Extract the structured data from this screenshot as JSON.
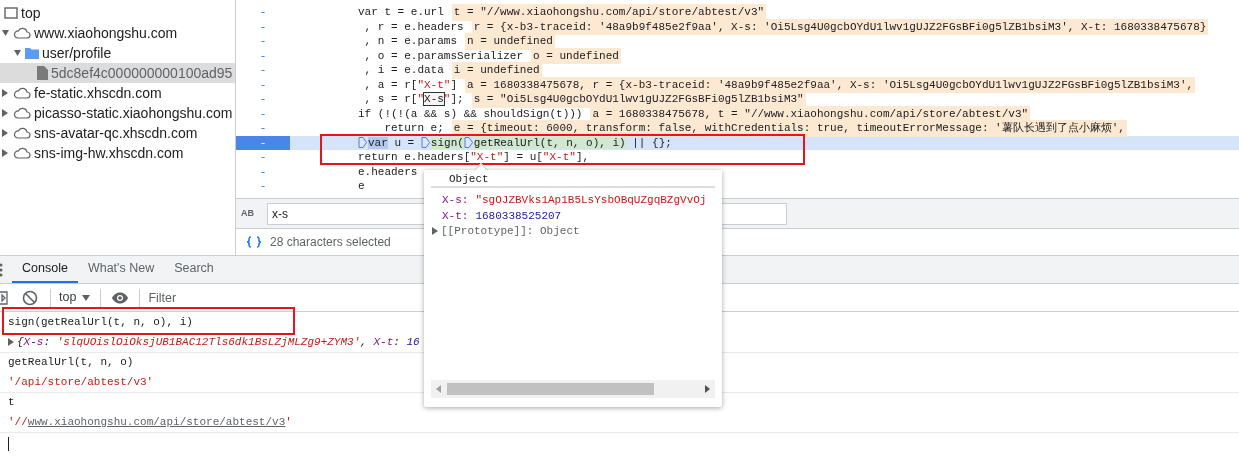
{
  "sources_tree": [
    {
      "kind": "frame",
      "label": "top",
      "selected": false
    },
    {
      "kind": "domain",
      "label": "www.xiaohongshu.com",
      "expanded": true,
      "selected": false,
      "children": [
        {
          "kind": "folder",
          "label": "user/profile",
          "expanded": true,
          "selected": false,
          "children": [
            {
              "kind": "file",
              "label": "5dc8ef4c000000000100ad95",
              "selected": true
            }
          ]
        }
      ]
    },
    {
      "kind": "domain",
      "label": "fe-static.xhscdn.com",
      "expanded": false,
      "selected": false
    },
    {
      "kind": "domain",
      "label": "picasso-static.xiaohongshu.com",
      "expanded": false,
      "selected": false
    },
    {
      "kind": "domain",
      "label": "sns-avatar-qc.xhscdn.com",
      "expanded": false,
      "selected": false
    },
    {
      "kind": "domain",
      "label": "sns-img-hw.xhscdn.com",
      "expanded": false,
      "selected": false
    }
  ],
  "editor": {
    "lines": [
      {
        "gutter": "-",
        "current": false,
        "segments": [
          {
            "kind": "code",
            "text": "          var t = e.url"
          }
        ],
        "inline_value": "t = \"//www.xiaohongshu.com/api/store/abtest/v3\""
      },
      {
        "gutter": "-",
        "current": false,
        "segments": [
          {
            "kind": "code",
            "text": "           , r = e.headers"
          }
        ],
        "inline_value": "r = {x-b3-traceid: '48a9b9f485e2f9aa', X-s: 'Oi5Lsg4U0gcbOYdU1lwv1gUJZ2FGsBFi0g5lZB1bsiM3', X-t: 1680338475678}"
      },
      {
        "gutter": "-",
        "current": false,
        "segments": [
          {
            "kind": "code",
            "text": "           , n = e.params"
          }
        ],
        "inline_value": "n = undefined"
      },
      {
        "gutter": "-",
        "current": false,
        "segments": [
          {
            "kind": "code",
            "text": "           , o = e.paramsSerializer"
          }
        ],
        "inline_value": "o = undefined"
      },
      {
        "gutter": "-",
        "current": false,
        "segments": [
          {
            "kind": "code",
            "text": "           , i = e.data"
          }
        ],
        "inline_value": "i = undefined"
      },
      {
        "gutter": "-",
        "current": false,
        "segments": [
          {
            "kind": "code",
            "text": "           , a = r["
          },
          {
            "kind": "string",
            "text": "\"X-t\""
          },
          {
            "kind": "code",
            "text": "]"
          }
        ],
        "inline_value": "a = 1680338475678, r = {x-b3-traceid: '48a9b9f485e2f9aa', X-s: 'Oi5Lsg4U0gcbOYdU1lwv1gUJZ2FGsBFi0g5lZB1bsiM3',"
      },
      {
        "gutter": "-",
        "current": false,
        "segments": [
          {
            "kind": "code",
            "text": "           , s = r["
          },
          {
            "kind": "string",
            "text": "\""
          },
          {
            "kind": "match",
            "text": "X-s"
          },
          {
            "kind": "string",
            "text": "\""
          },
          {
            "kind": "code",
            "text": "];"
          }
        ],
        "inline_value": "s = \"Oi5Lsg4U0gcbOYdU1lwv1gUJZ2FGsBFi0g5lZB1bsiM3\""
      },
      {
        "gutter": "-",
        "current": false,
        "segments": [
          {
            "kind": "code",
            "text": "          if (!(!(a && s) && shouldSign(t)))"
          }
        ],
        "inline_value": "a = 1680338475678, t = \"//www.xiaohongshu.com/api/store/abtest/v3\""
      },
      {
        "gutter": "-",
        "current": false,
        "segments": [
          {
            "kind": "code",
            "text": "              return e;"
          }
        ],
        "inline_value": "e = {timeout: 6000, transform: false, withCredentials: true, timeoutErrorMessage: '薯队长遇到了点小麻烦',"
      },
      {
        "gutter": "-",
        "current": true,
        "segments": [
          {
            "kind": "marker"
          },
          {
            "kind": "word-highlight",
            "text": "var"
          },
          {
            "kind": "code",
            "text": " u = "
          },
          {
            "kind": "marker"
          },
          {
            "kind": "selection",
            "text": "sign("
          },
          {
            "kind": "marker"
          },
          {
            "kind": "selection",
            "text": "getRealUrl(t, n, o), i)"
          },
          {
            "kind": "code",
            "text": " || {};"
          }
        ]
      },
      {
        "gutter": "-",
        "current": false,
        "segments": [
          {
            "kind": "code",
            "text": "          return e.headers["
          },
          {
            "kind": "string",
            "text": "\"X-t\""
          },
          {
            "kind": "code",
            "text": "] = u["
          },
          {
            "kind": "string",
            "text": "\"X-t\""
          },
          {
            "kind": "code",
            "text": "],"
          }
        ]
      },
      {
        "gutter": "-",
        "current": false,
        "segments": [
          {
            "kind": "code",
            "text": "          e.headers"
          }
        ]
      },
      {
        "gutter": "-",
        "current": false,
        "segments": [
          {
            "kind": "code",
            "text": "          e"
          }
        ]
      }
    ]
  },
  "search_bar": {
    "case_toggle": "AB",
    "value": "x-s"
  },
  "status_bar": {
    "text": "28 characters selected"
  },
  "console": {
    "tabs": [
      {
        "label": "Console",
        "selected": true
      },
      {
        "label": "What's New",
        "selected": false
      },
      {
        "label": "Search",
        "selected": false
      }
    ],
    "context": "top",
    "filter": {
      "placeholder": "Filter"
    },
    "entries": [
      {
        "kind": "input",
        "segments": [
          {
            "kind": "code",
            "text": "sign(getRealUrl(t, n, o), i)"
          }
        ]
      },
      {
        "kind": "result",
        "segments": [
          {
            "kind": "code",
            "text": "{"
          },
          {
            "kind": "key",
            "text": "X-s"
          },
          {
            "kind": "code",
            "text": ": "
          },
          {
            "kind": "string",
            "text": "'slqUOislOiOksjUB1BAC12Tls6dk1BsLZjMLZg9+ZYM3'"
          },
          {
            "kind": "code",
            "text": ", "
          },
          {
            "kind": "key",
            "text": "X-t"
          },
          {
            "kind": "code",
            "text": ": "
          },
          {
            "kind": "number",
            "text": "16"
          }
        ]
      },
      {
        "kind": "input",
        "segments": [
          {
            "kind": "code",
            "text": "getRealUrl(t, n, o)"
          }
        ]
      },
      {
        "kind": "result",
        "segments": [
          {
            "kind": "string",
            "text": "'/api/store/abtest/v3'"
          }
        ]
      },
      {
        "kind": "input",
        "segments": [
          {
            "kind": "code",
            "text": "t"
          }
        ]
      },
      {
        "kind": "result",
        "segments": [
          {
            "kind": "string",
            "text": "'//"
          },
          {
            "kind": "link",
            "text": "www.xiaohongshu.com/api/store/abtest/v3"
          },
          {
            "kind": "string",
            "text": "'"
          }
        ]
      }
    ]
  },
  "popup": {
    "title": "Object",
    "properties": [
      {
        "key": "X-s:",
        "kind": "string",
        "value": "\"sgOJZBVks1Ap1B5LsYsbOBqUZgqBZgVvOj"
      },
      {
        "key": "X-t:",
        "kind": "number",
        "value": "1680338525207"
      }
    ],
    "prototype": "[[Prototype]]: Object"
  }
}
